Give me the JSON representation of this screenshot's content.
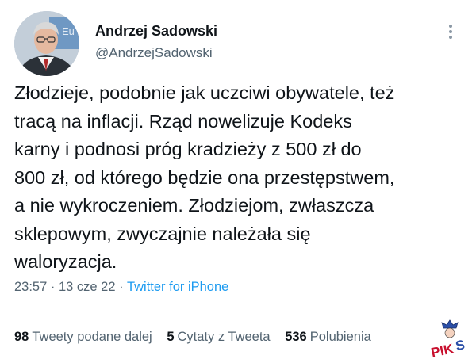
{
  "author": {
    "display_name": "Andrzej Sadowski",
    "handle": "@AndrzejSadowski"
  },
  "tweet": {
    "text": "Złodzieje, podobnie jak uczciwi obywatele, też\ntracą na inflacji. Rząd nowelizuje Kodeks\nkarny i podnosi próg kradzieży z 500 zł do\n800 zł, od którego będzie ona przestępstwem,\na nie wykroczeniem. Złodziejom, zwłaszcza\nsklepowym, zwyczajnie należała się\nwaloryzacja.",
    "time": "23:57",
    "date": "13 cze 22",
    "separator": "·",
    "source": "Twitter for iPhone"
  },
  "stats": [
    {
      "count": "98",
      "label": "Tweety podane dalej"
    },
    {
      "count": "5",
      "label": "Cytaty z Tweeta"
    },
    {
      "count": "536",
      "label": "Polubienia"
    }
  ],
  "icons": {
    "more": "more-options-icon",
    "watermark": "pikus-logo"
  },
  "colors": {
    "link": "#1d9bf0",
    "secondary_text": "#536471",
    "primary_text": "#0f1419"
  },
  "watermark_text": "PIKUS"
}
